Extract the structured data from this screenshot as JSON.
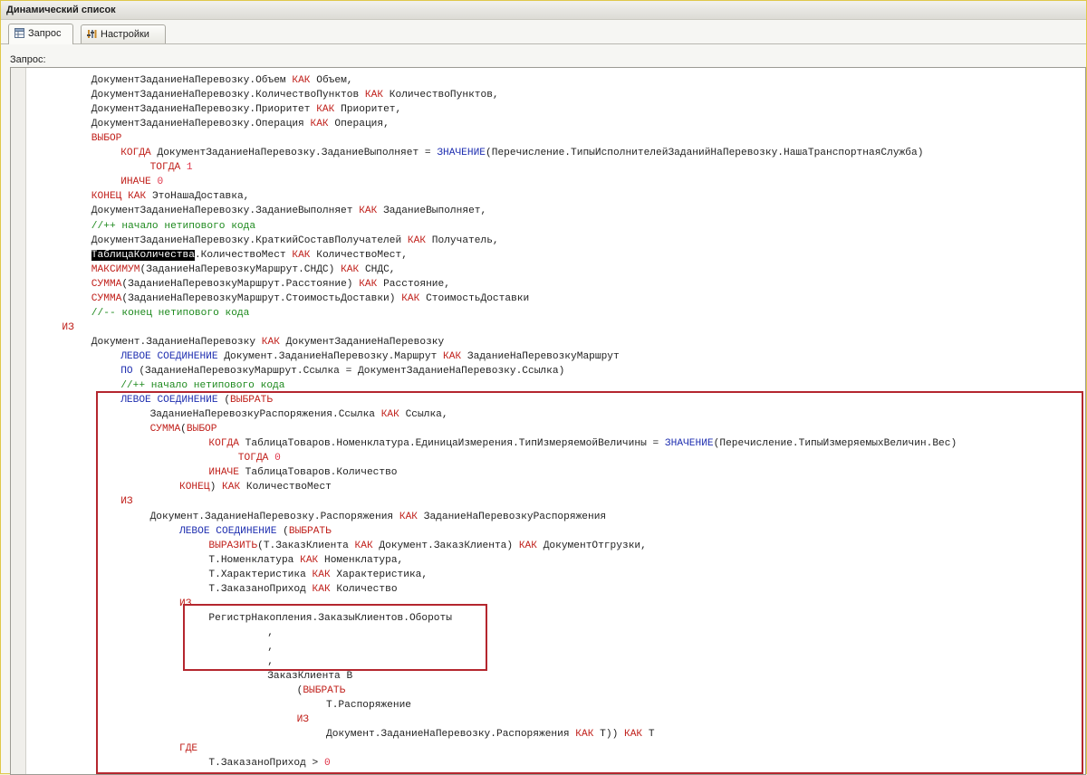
{
  "window": {
    "title": "Динамический список"
  },
  "tabs": [
    {
      "label": "Запрос",
      "icon": "table-icon",
      "active": true
    },
    {
      "label": "Настройки",
      "icon": "settings-icon",
      "active": false
    }
  ],
  "query_label": "Запрос:",
  "colors": {
    "keyword": "#c0201b",
    "function": "#1f2fb0",
    "number": "#e0354a",
    "comment": "#1e8a1e",
    "highlight_box": "#b4262e"
  },
  "code_lines": [
    {
      "indent": 8,
      "tokens": [
        [
          "plain",
          "ДокументЗаданиеНаПеревозку.Объем "
        ],
        [
          "kw",
          "КАК"
        ],
        [
          "plain",
          " Объем,"
        ]
      ]
    },
    {
      "indent": 8,
      "tokens": [
        [
          "plain",
          "ДокументЗаданиеНаПеревозку.КоличествоПунктов "
        ],
        [
          "kw",
          "КАК"
        ],
        [
          "plain",
          " КоличествоПунктов,"
        ]
      ]
    },
    {
      "indent": 8,
      "tokens": [
        [
          "plain",
          "ДокументЗаданиеНаПеревозку.Приоритет "
        ],
        [
          "kw",
          "КАК"
        ],
        [
          "plain",
          " Приоритет,"
        ]
      ]
    },
    {
      "indent": 8,
      "tokens": [
        [
          "plain",
          "ДокументЗаданиеНаПеревозку.Операция "
        ],
        [
          "kw",
          "КАК"
        ],
        [
          "plain",
          " Операция,"
        ]
      ]
    },
    {
      "indent": 8,
      "tokens": [
        [
          "kw",
          "ВЫБОР"
        ]
      ]
    },
    {
      "indent": 12,
      "tokens": [
        [
          "kw",
          "КОГДА"
        ],
        [
          "plain",
          " ДокументЗаданиеНаПеревозку.ЗаданиеВыполняет = "
        ],
        [
          "fn",
          "ЗНАЧЕНИЕ"
        ],
        [
          "plain",
          "(Перечисление.ТипыИсполнителейЗаданийНаПеревозку.НашаТранспортнаяСлужба)"
        ]
      ]
    },
    {
      "indent": 16,
      "tokens": [
        [
          "kw",
          "ТОГДА"
        ],
        [
          "plain",
          " "
        ],
        [
          "num",
          "1"
        ]
      ]
    },
    {
      "indent": 12,
      "tokens": [
        [
          "kw",
          "ИНАЧЕ"
        ],
        [
          "plain",
          " "
        ],
        [
          "num",
          "0"
        ]
      ]
    },
    {
      "indent": 8,
      "tokens": [
        [
          "kw",
          "КОНЕЦ"
        ],
        [
          "plain",
          " "
        ],
        [
          "kw",
          "КАК"
        ],
        [
          "plain",
          " ЭтоНашаДоставка,"
        ]
      ]
    },
    {
      "indent": 8,
      "tokens": [
        [
          "plain",
          "ДокументЗаданиеНаПеревозку.ЗаданиеВыполняет "
        ],
        [
          "kw",
          "КАК"
        ],
        [
          "plain",
          " ЗаданиеВыполняет,"
        ]
      ]
    },
    {
      "indent": 8,
      "tokens": [
        [
          "cm",
          "//++ начало нетипового кода"
        ]
      ]
    },
    {
      "indent": 8,
      "tokens": [
        [
          "plain",
          "ДокументЗаданиеНаПеревозку.КраткийСоставПолучателей "
        ],
        [
          "kw",
          "КАК"
        ],
        [
          "plain",
          " Получатель,"
        ]
      ]
    },
    {
      "indent": 8,
      "tokens": [
        [
          "hl",
          "ТаблицаКоличества"
        ],
        [
          "plain",
          ".КоличествоМест "
        ],
        [
          "kw",
          "КАК"
        ],
        [
          "plain",
          " КоличествоМест,"
        ]
      ]
    },
    {
      "indent": 8,
      "tokens": [
        [
          "kw",
          "МАКСИМУМ"
        ],
        [
          "plain",
          "(ЗаданиеНаПеревозкуМаршрут.СНДС) "
        ],
        [
          "kw",
          "КАК"
        ],
        [
          "plain",
          " СНДС,"
        ]
      ]
    },
    {
      "indent": 8,
      "tokens": [
        [
          "kw",
          "СУММА"
        ],
        [
          "plain",
          "(ЗаданиеНаПеревозкуМаршрут.Расстояние) "
        ],
        [
          "kw",
          "КАК"
        ],
        [
          "plain",
          " Расстояние,"
        ]
      ]
    },
    {
      "indent": 8,
      "tokens": [
        [
          "kw",
          "СУММА"
        ],
        [
          "plain",
          "(ЗаданиеНаПеревозкуМаршрут.СтоимостьДоставки) "
        ],
        [
          "kw",
          "КАК"
        ],
        [
          "plain",
          " СтоимостьДоставки"
        ]
      ]
    },
    {
      "indent": 8,
      "tokens": [
        [
          "cm",
          "//-- конец нетипового кода"
        ]
      ]
    },
    {
      "indent": 4,
      "tokens": [
        [
          "kw",
          "ИЗ"
        ]
      ]
    },
    {
      "indent": 8,
      "tokens": [
        [
          "plain",
          "Документ.ЗаданиеНаПеревозку "
        ],
        [
          "kw",
          "КАК"
        ],
        [
          "plain",
          " ДокументЗаданиеНаПеревозку"
        ]
      ]
    },
    {
      "indent": 12,
      "tokens": [
        [
          "fn",
          "ЛЕВОЕ СОЕДИНЕНИЕ"
        ],
        [
          "plain",
          " Документ.ЗаданиеНаПеревозку.Маршрут "
        ],
        [
          "kw",
          "КАК"
        ],
        [
          "plain",
          " ЗаданиеНаПеревозкуМаршрут"
        ]
      ]
    },
    {
      "indent": 12,
      "tokens": [
        [
          "fn",
          "ПО"
        ],
        [
          "plain",
          " (ЗаданиеНаПеревозкуМаршрут.Ссылка = ДокументЗаданиеНаПеревозку.Ссылка)"
        ]
      ]
    },
    {
      "indent": 12,
      "tokens": [
        [
          "cm",
          "//++ начало нетипового кода"
        ]
      ]
    },
    {
      "indent": 12,
      "tokens": [
        [
          "fn",
          "ЛЕВОЕ СОЕДИНЕНИЕ"
        ],
        [
          "plain",
          " ("
        ],
        [
          "kw",
          "ВЫБРАТЬ"
        ]
      ]
    },
    {
      "indent": 16,
      "tokens": [
        [
          "plain",
          "ЗаданиеНаПеревозкуРаспоряжения.Ссылка "
        ],
        [
          "kw",
          "КАК"
        ],
        [
          "plain",
          " Ссылка,"
        ]
      ]
    },
    {
      "indent": 16,
      "tokens": [
        [
          "kw",
          "СУММА"
        ],
        [
          "plain",
          "("
        ],
        [
          "kw",
          "ВЫБОР"
        ]
      ]
    },
    {
      "indent": 24,
      "tokens": [
        [
          "kw",
          "КОГДА"
        ],
        [
          "plain",
          " ТаблицаТоваров.Номенклатура.ЕдиницаИзмерения.ТипИзмеряемойВеличины = "
        ],
        [
          "fn",
          "ЗНАЧЕНИЕ"
        ],
        [
          "plain",
          "(Перечисление.ТипыИзмеряемыхВеличин.Вес)"
        ]
      ]
    },
    {
      "indent": 28,
      "tokens": [
        [
          "kw",
          "ТОГДА"
        ],
        [
          "plain",
          " "
        ],
        [
          "num",
          "0"
        ]
      ]
    },
    {
      "indent": 24,
      "tokens": [
        [
          "kw",
          "ИНАЧЕ"
        ],
        [
          "plain",
          " ТаблицаТоваров.Количество"
        ]
      ]
    },
    {
      "indent": 20,
      "tokens": [
        [
          "kw",
          "КОНЕЦ"
        ],
        [
          "plain",
          ") "
        ],
        [
          "kw",
          "КАК"
        ],
        [
          "plain",
          " КоличествоМест"
        ]
      ]
    },
    {
      "indent": 12,
      "tokens": [
        [
          "kw",
          "ИЗ"
        ]
      ]
    },
    {
      "indent": 16,
      "tokens": [
        [
          "plain",
          "Документ.ЗаданиеНаПеревозку.Распоряжения "
        ],
        [
          "kw",
          "КАК"
        ],
        [
          "plain",
          " ЗаданиеНаПеревозкуРаспоряжения"
        ]
      ]
    },
    {
      "indent": 20,
      "tokens": [
        [
          "fn",
          "ЛЕВОЕ СОЕДИНЕНИЕ"
        ],
        [
          "plain",
          " ("
        ],
        [
          "kw",
          "ВЫБРАТЬ"
        ]
      ]
    },
    {
      "indent": 24,
      "tokens": [
        [
          "kw",
          "ВЫРАЗИТЬ"
        ],
        [
          "plain",
          "(Т.ЗаказКлиента "
        ],
        [
          "kw",
          "КАК"
        ],
        [
          "plain",
          " Документ.ЗаказКлиента) "
        ],
        [
          "kw",
          "КАК"
        ],
        [
          "plain",
          " ДокументОтгрузки,"
        ]
      ]
    },
    {
      "indent": 24,
      "tokens": [
        [
          "plain",
          "Т.Номенклатура "
        ],
        [
          "kw",
          "КАК"
        ],
        [
          "plain",
          " Номенклатура,"
        ]
      ]
    },
    {
      "indent": 24,
      "tokens": [
        [
          "plain",
          "Т.Характеристика "
        ],
        [
          "kw",
          "КАК"
        ],
        [
          "plain",
          " Характеристика,"
        ]
      ]
    },
    {
      "indent": 24,
      "tokens": [
        [
          "plain",
          "Т.ЗаказаноПриход "
        ],
        [
          "kw",
          "КАК"
        ],
        [
          "plain",
          " Количество"
        ]
      ]
    },
    {
      "indent": 20,
      "tokens": [
        [
          "kw",
          "ИЗ"
        ]
      ]
    },
    {
      "indent": 24,
      "tokens": [
        [
          "plain",
          "РегистрНакопления.ЗаказыКлиентов.Обороты"
        ]
      ]
    },
    {
      "indent": 32,
      "tokens": [
        [
          "plain",
          ","
        ]
      ]
    },
    {
      "indent": 32,
      "tokens": [
        [
          "plain",
          ","
        ]
      ]
    },
    {
      "indent": 32,
      "tokens": [
        [
          "plain",
          ","
        ]
      ]
    },
    {
      "indent": 32,
      "tokens": [
        [
          "plain",
          "ЗаказКлиента В"
        ]
      ]
    },
    {
      "indent": 36,
      "tokens": [
        [
          "plain",
          "("
        ],
        [
          "kw",
          "ВЫБРАТЬ"
        ]
      ]
    },
    {
      "indent": 40,
      "tokens": [
        [
          "plain",
          "Т.Распоряжение"
        ]
      ]
    },
    {
      "indent": 36,
      "tokens": [
        [
          "kw",
          "ИЗ"
        ]
      ]
    },
    {
      "indent": 40,
      "tokens": [
        [
          "plain",
          "Документ.ЗаданиеНаПеревозку.Распоряжения "
        ],
        [
          "kw",
          "КАК"
        ],
        [
          "plain",
          " Т)) "
        ],
        [
          "kw",
          "КАК"
        ],
        [
          "plain",
          " Т"
        ]
      ]
    },
    {
      "indent": 20,
      "tokens": [
        [
          "kw",
          "ГДЕ"
        ]
      ]
    },
    {
      "indent": 24,
      "tokens": [
        [
          "plain",
          "Т.ЗаказаноПриход > "
        ],
        [
          "num",
          "0"
        ]
      ]
    }
  ]
}
